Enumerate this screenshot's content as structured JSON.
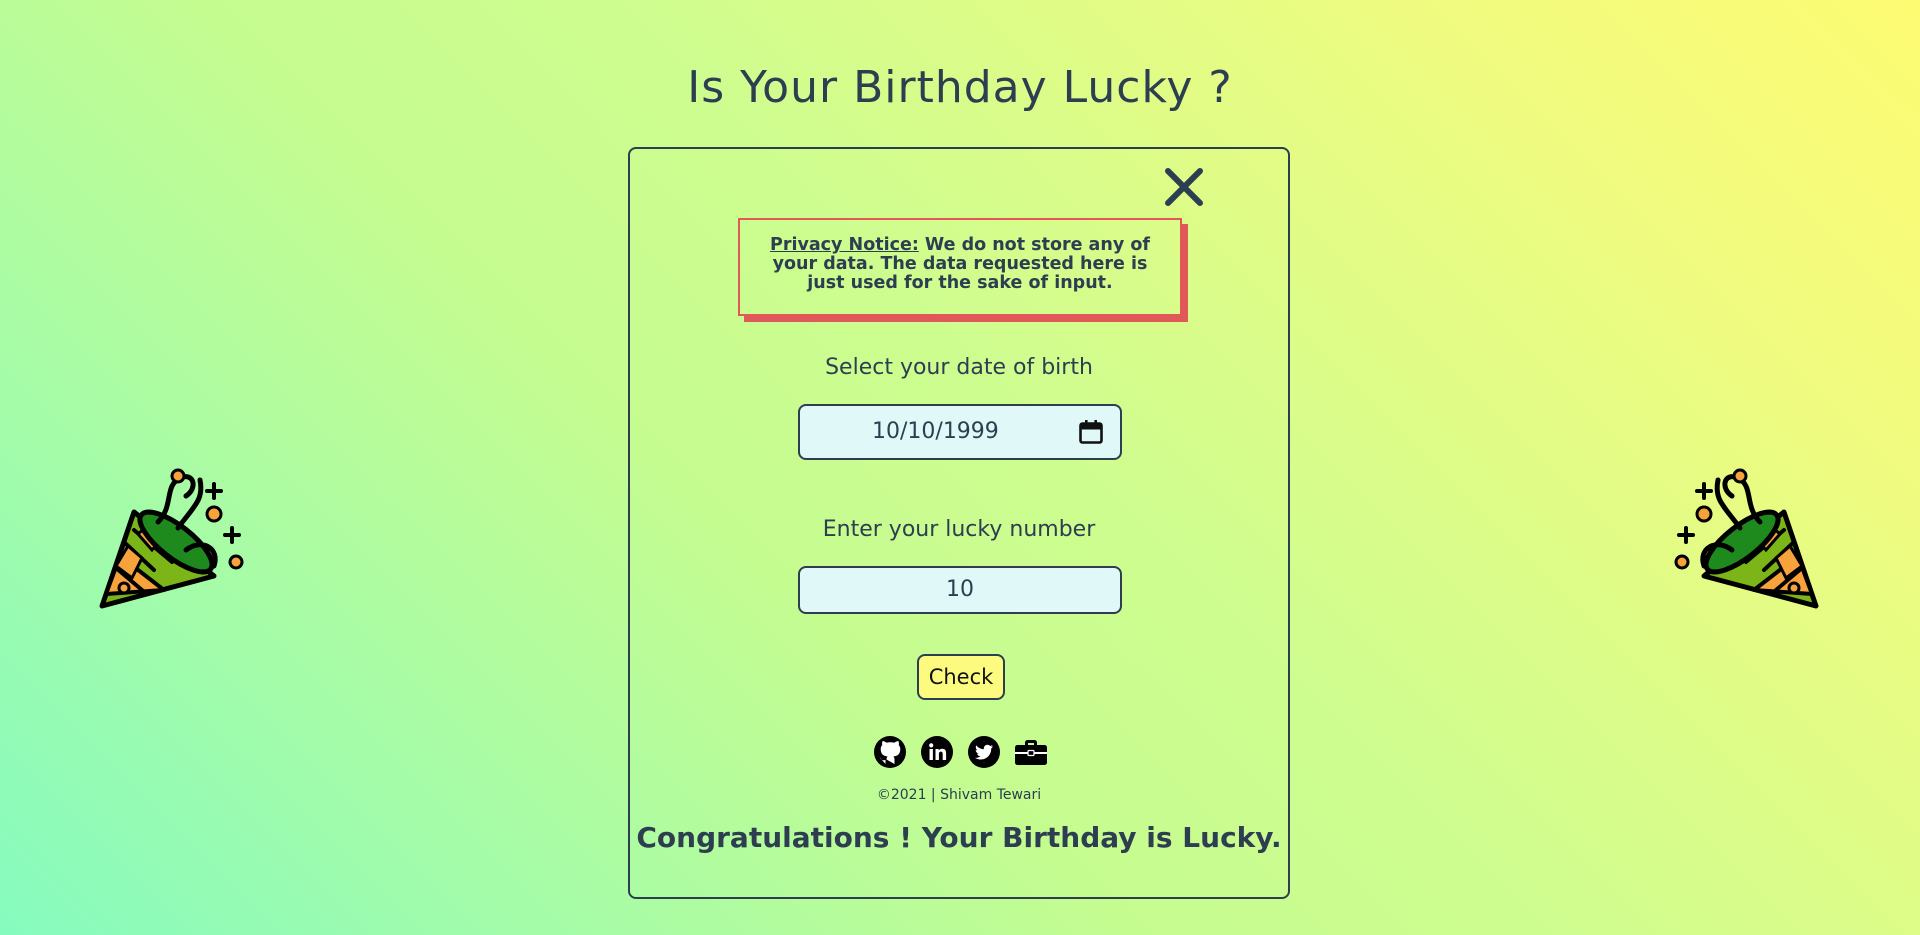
{
  "page": {
    "title": "Is Your Birthday Lucky ?"
  },
  "notice": {
    "label": "Privacy Notice:",
    "text": " We do not store any of your data. The data requested here is just used for the sake of input."
  },
  "form": {
    "dob_label": "Select your date of birth",
    "dob_value": "10/10/1999",
    "lucky_label": "Enter your lucky number",
    "lucky_value": "10",
    "check_label": "Check"
  },
  "footer": {
    "copyright": "©2021 | Shivam Tewari"
  },
  "result": {
    "message": "Congratulations ! Your Birthday is Lucky."
  },
  "icons": {
    "close": "close-icon",
    "calendar": "calendar-icon",
    "github": "github-icon",
    "linkedin": "linkedin-icon",
    "twitter": "twitter-icon",
    "portfolio": "briefcase-icon",
    "party": "party-popper-icon"
  },
  "colors": {
    "text": "#2c3e50",
    "notice_border": "#e05858",
    "input_bg": "#e0f8f8",
    "button_bg": "#fdfb7f",
    "gradient_start": "#86fbbf",
    "gradient_end": "#fdfb72"
  }
}
